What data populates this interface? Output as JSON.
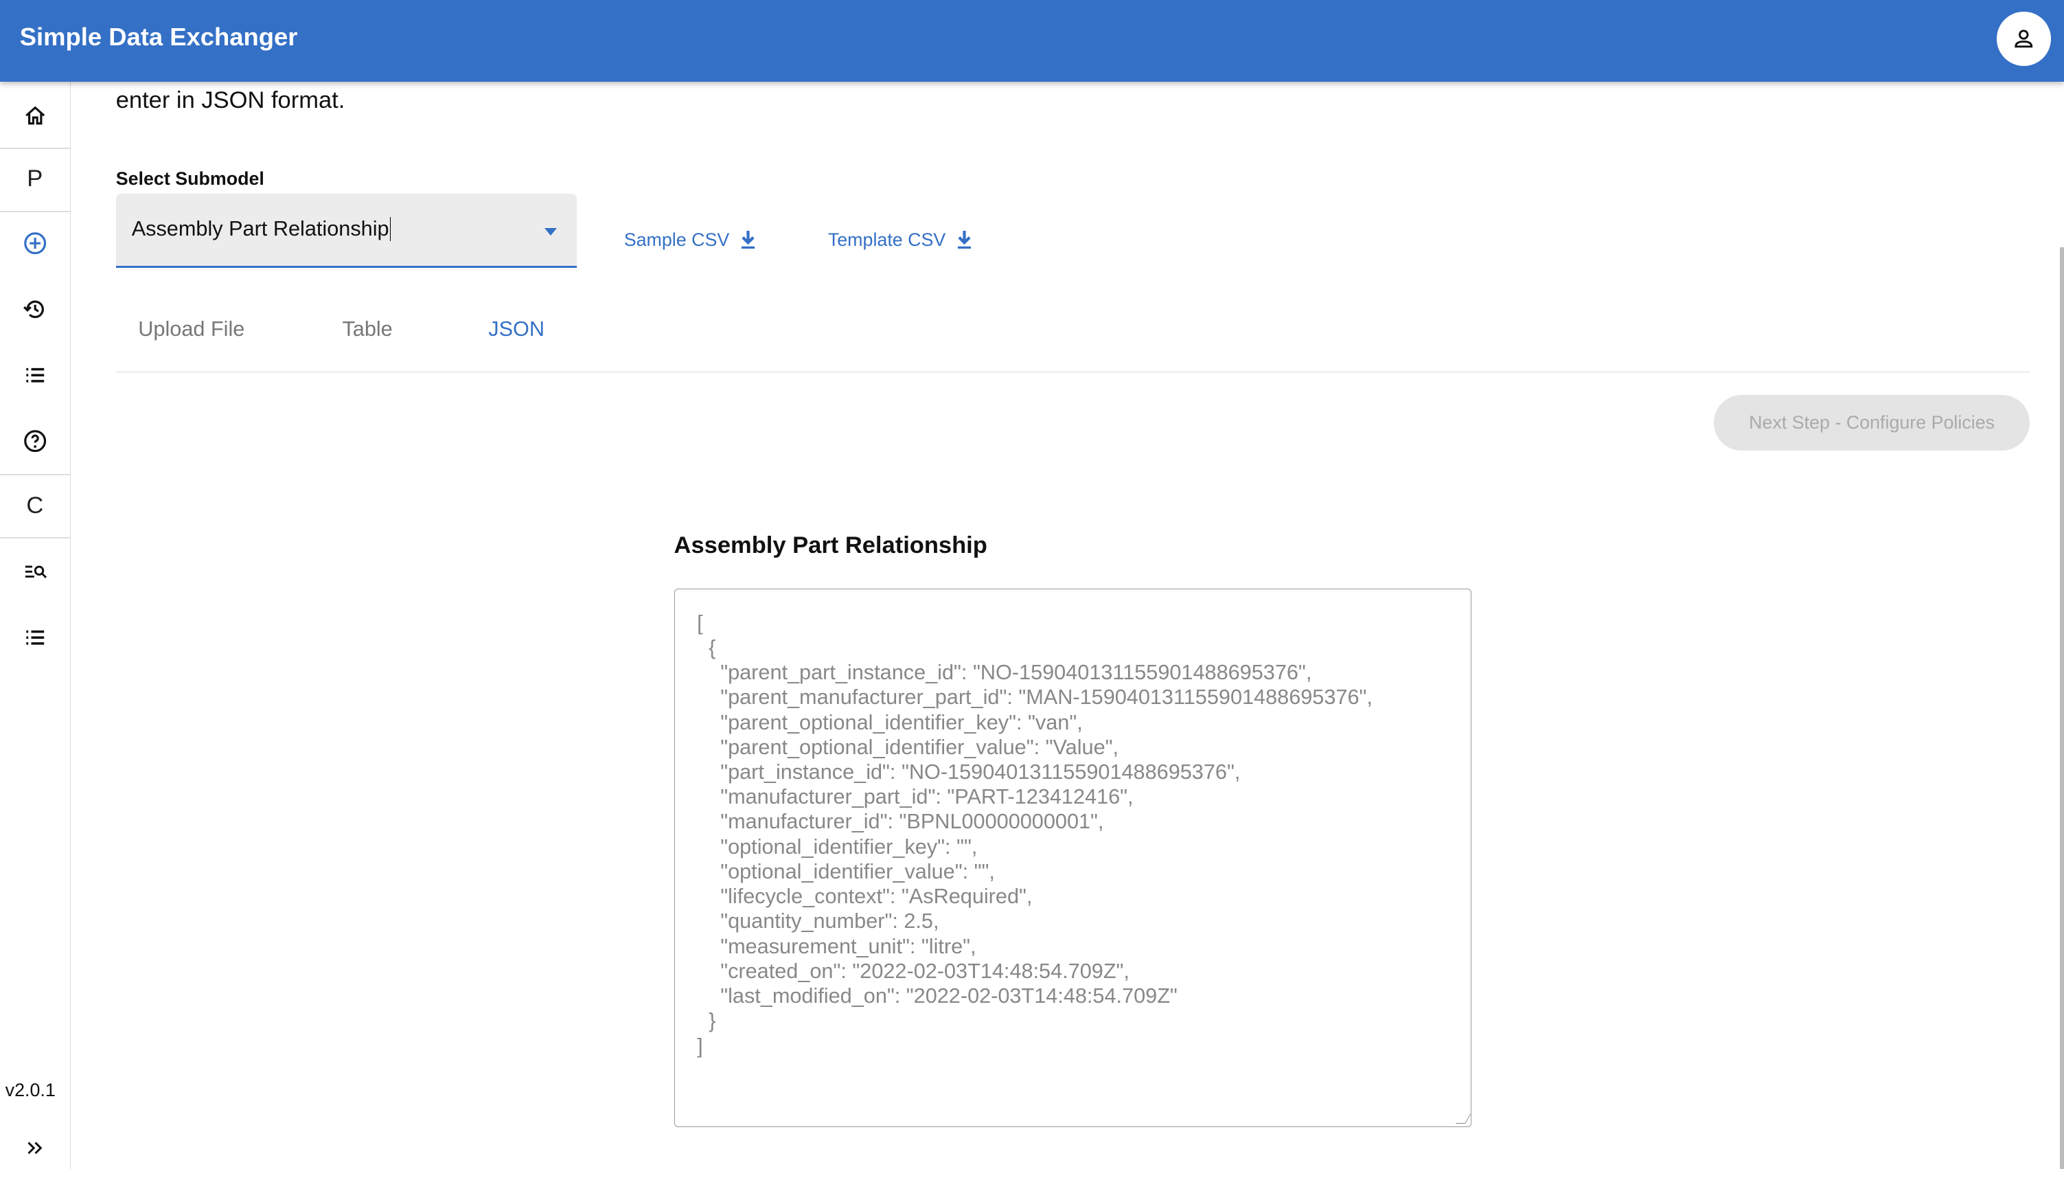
{
  "header": {
    "title": "Simple Data Exchanger"
  },
  "sidebar": {
    "p_label": "P",
    "c_label": "C",
    "version": "v2.0.1"
  },
  "main": {
    "intro": "enter in JSON format.",
    "select_label": "Select Submodel",
    "select_value": "Assembly Part Relationship",
    "sample_csv": "Sample CSV",
    "template_csv": "Template CSV",
    "tabs": [
      {
        "label": "Upload File"
      },
      {
        "label": "Table"
      },
      {
        "label": "JSON"
      }
    ],
    "next_button": "Next Step - Configure Policies",
    "json_title": "Assembly Part Relationship",
    "json_text": "[\n  {\n    \"parent_part_instance_id\": \"NO-159040131155901488695376\",\n    \"parent_manufacturer_part_id\": \"MAN-159040131155901488695376\",\n    \"parent_optional_identifier_key\": \"van\",\n    \"parent_optional_identifier_value\": \"Value\",\n    \"part_instance_id\": \"NO-159040131155901488695376\",\n    \"manufacturer_part_id\": \"PART-123412416\",\n    \"manufacturer_id\": \"BPNL00000000001\",\n    \"optional_identifier_key\": \"\",\n    \"optional_identifier_value\": \"\",\n    \"lifecycle_context\": \"AsRequired\",\n    \"quantity_number\": 2.5,\n    \"measurement_unit\": \"litre\",\n    \"created_on\": \"2022-02-03T14:48:54.709Z\",\n    \"last_modified_on\": \"2022-02-03T14:48:54.709Z\"\n  }\n]"
  },
  "colors": {
    "primary": "#3470c6"
  }
}
